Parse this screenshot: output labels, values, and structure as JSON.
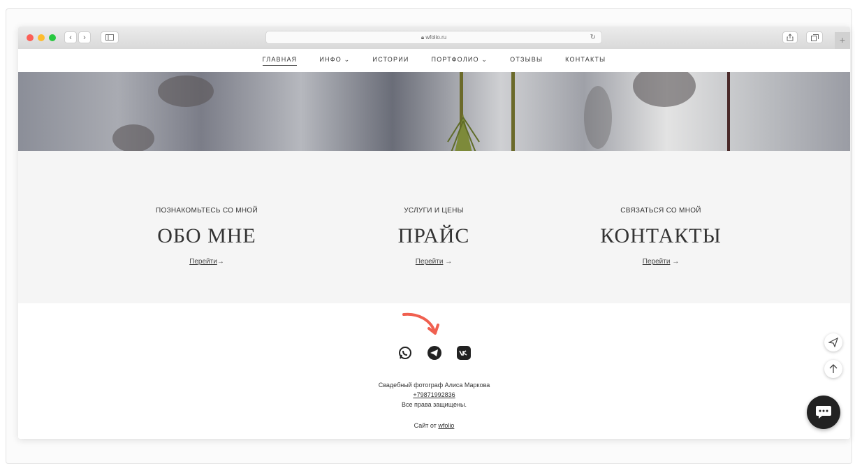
{
  "browser": {
    "url": "wfolio.ru",
    "back_label": "‹",
    "forward_label": "›",
    "plus_label": "+"
  },
  "nav": {
    "items": [
      {
        "label": "ГЛАВНАЯ",
        "active": true
      },
      {
        "label": "ИНФО ⌄"
      },
      {
        "label": "ИСТОРИИ"
      },
      {
        "label": "ПОРТФОЛИО ⌄"
      },
      {
        "label": "ОТЗЫВЫ"
      },
      {
        "label": "КОНТАКТЫ"
      }
    ]
  },
  "cards": [
    {
      "subtitle": "ПОЗНАКОМЬТЕСЬ СО МНОЙ",
      "title": "ОБО МНЕ",
      "link": "Перейти",
      "arrow": "→"
    },
    {
      "subtitle": "УСЛУГИ И ЦЕНЫ",
      "title": "ПРАЙС",
      "link": "Перейти",
      "arrow": " →"
    },
    {
      "subtitle": "СВЯЗАТЬСЯ СО МНОЙ",
      "title": "КОНТАКТЫ",
      "link": "Перейти",
      "arrow": " →"
    }
  ],
  "footer": {
    "social_icons": [
      "whatsapp-icon",
      "telegram-icon",
      "vk-icon"
    ],
    "owner": "Свадебный фотограф Алиса Маркова",
    "phone": "+79871992836",
    "rights": "Все права защищены.",
    "site_prefix": "Сайт от ",
    "site_link": "wfolio"
  },
  "colors": {
    "arrow": "#f06050",
    "chat": "#222222"
  }
}
